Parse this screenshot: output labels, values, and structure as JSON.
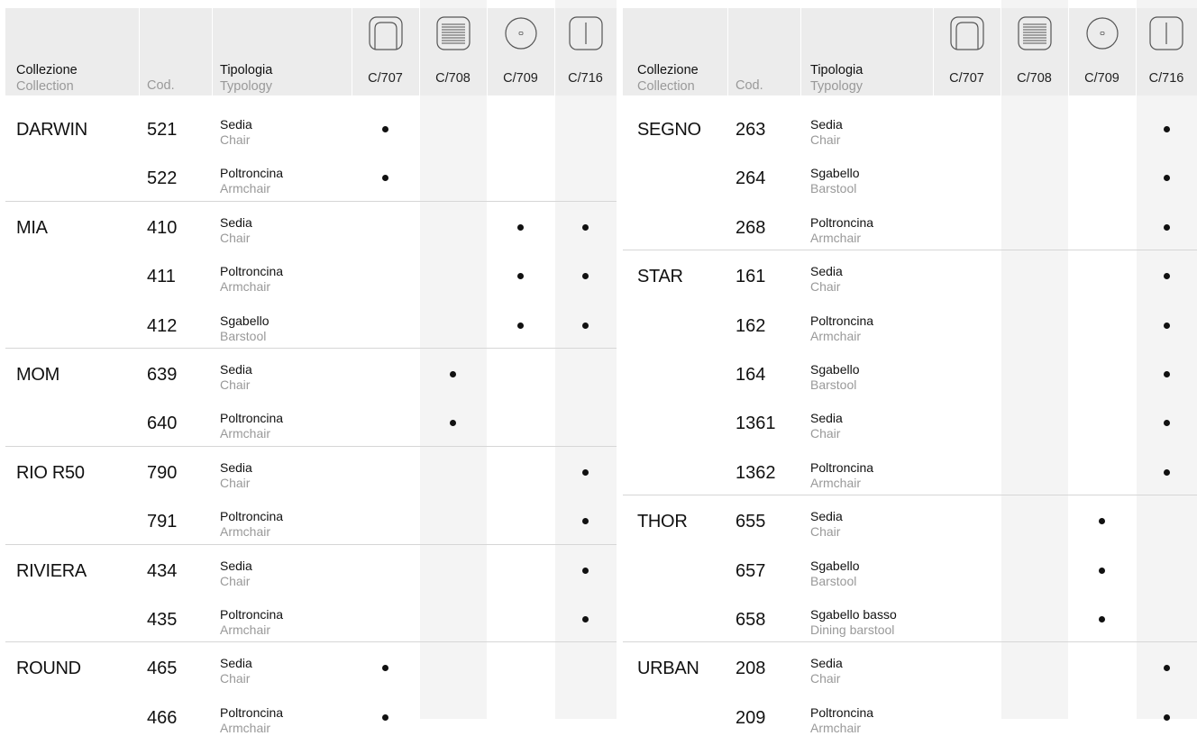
{
  "header": {
    "collection_it": "Collezione",
    "collection_en": "Collection",
    "code": "Cod.",
    "typology_it": "Tipologia",
    "typology_en": "Typology",
    "columns": [
      {
        "label": "C/707",
        "icon": "rounded-frame-icon"
      },
      {
        "label": "C/708",
        "icon": "horizontal-lines-icon"
      },
      {
        "label": "C/709",
        "icon": "circle-dot-icon"
      },
      {
        "label": "C/716",
        "icon": "vertical-line-icon"
      }
    ]
  },
  "left_rows": [
    {
      "collection": "DARWIN",
      "code": "521",
      "it": "Sedia",
      "en": "Chair",
      "marks": [
        0
      ]
    },
    {
      "collection": "",
      "code": "522",
      "it": "Poltroncina",
      "en": "Armchair",
      "marks": [
        0
      ]
    },
    {
      "collection": "MIA",
      "code": "410",
      "it": "Sedia",
      "en": "Chair",
      "marks": [
        2,
        3
      ]
    },
    {
      "collection": "",
      "code": "411",
      "it": "Poltroncina",
      "en": "Armchair",
      "marks": [
        2,
        3
      ]
    },
    {
      "collection": "",
      "code": "412",
      "it": "Sgabello",
      "en": "Barstool",
      "marks": [
        2,
        3
      ]
    },
    {
      "collection": "MOM",
      "code": "639",
      "it": "Sedia",
      "en": "Chair",
      "marks": [
        1
      ]
    },
    {
      "collection": "",
      "code": "640",
      "it": "Poltroncina",
      "en": "Armchair",
      "marks": [
        1
      ]
    },
    {
      "collection": "RIO R50",
      "code": "790",
      "it": "Sedia",
      "en": "Chair",
      "marks": [
        3
      ]
    },
    {
      "collection": "",
      "code": "791",
      "it": "Poltroncina",
      "en": "Armchair",
      "marks": [
        3
      ]
    },
    {
      "collection": "RIVIERA",
      "code": "434",
      "it": "Sedia",
      "en": "Chair",
      "marks": [
        3
      ]
    },
    {
      "collection": "",
      "code": "435",
      "it": "Poltroncina",
      "en": "Armchair",
      "marks": [
        3
      ]
    },
    {
      "collection": "ROUND",
      "code": "465",
      "it": "Sedia",
      "en": "Chair",
      "marks": [
        0
      ]
    },
    {
      "collection": "",
      "code": "466",
      "it": "Poltroncina",
      "en": "Armchair",
      "marks": [
        0
      ]
    }
  ],
  "right_rows": [
    {
      "collection": "SEGNO",
      "code": "263",
      "it": "Sedia",
      "en": "Chair",
      "marks": [
        3
      ]
    },
    {
      "collection": "",
      "code": "264",
      "it": "Sgabello",
      "en": "Barstool",
      "marks": [
        3
      ]
    },
    {
      "collection": "",
      "code": "268",
      "it": "Poltroncina",
      "en": "Armchair",
      "marks": [
        3
      ]
    },
    {
      "collection": "STAR",
      "code": "161",
      "it": "Sedia",
      "en": "Chair",
      "marks": [
        3
      ]
    },
    {
      "collection": "",
      "code": "162",
      "it": "Poltroncina",
      "en": "Armchair",
      "marks": [
        3
      ]
    },
    {
      "collection": "",
      "code": "164",
      "it": "Sgabello",
      "en": "Barstool",
      "marks": [
        3
      ]
    },
    {
      "collection": "",
      "code": "1361",
      "it": "Sedia",
      "en": "Chair",
      "marks": [
        3
      ]
    },
    {
      "collection": "",
      "code": "1362",
      "it": "Poltroncina",
      "en": "Armchair",
      "marks": [
        3
      ]
    },
    {
      "collection": "THOR",
      "code": "655",
      "it": "Sedia",
      "en": "Chair",
      "marks": [
        2
      ]
    },
    {
      "collection": "",
      "code": "657",
      "it": "Sgabello",
      "en": "Barstool",
      "marks": [
        2
      ]
    },
    {
      "collection": "",
      "code": "658",
      "it": "Sgabello basso",
      "en": "Dining barstool",
      "marks": [
        2
      ]
    },
    {
      "collection": "URBAN",
      "code": "208",
      "it": "Sedia",
      "en": "Chair",
      "marks": [
        3
      ]
    },
    {
      "collection": "",
      "code": "209",
      "it": "Poltroncina",
      "en": "Armchair",
      "marks": [
        3
      ]
    }
  ]
}
